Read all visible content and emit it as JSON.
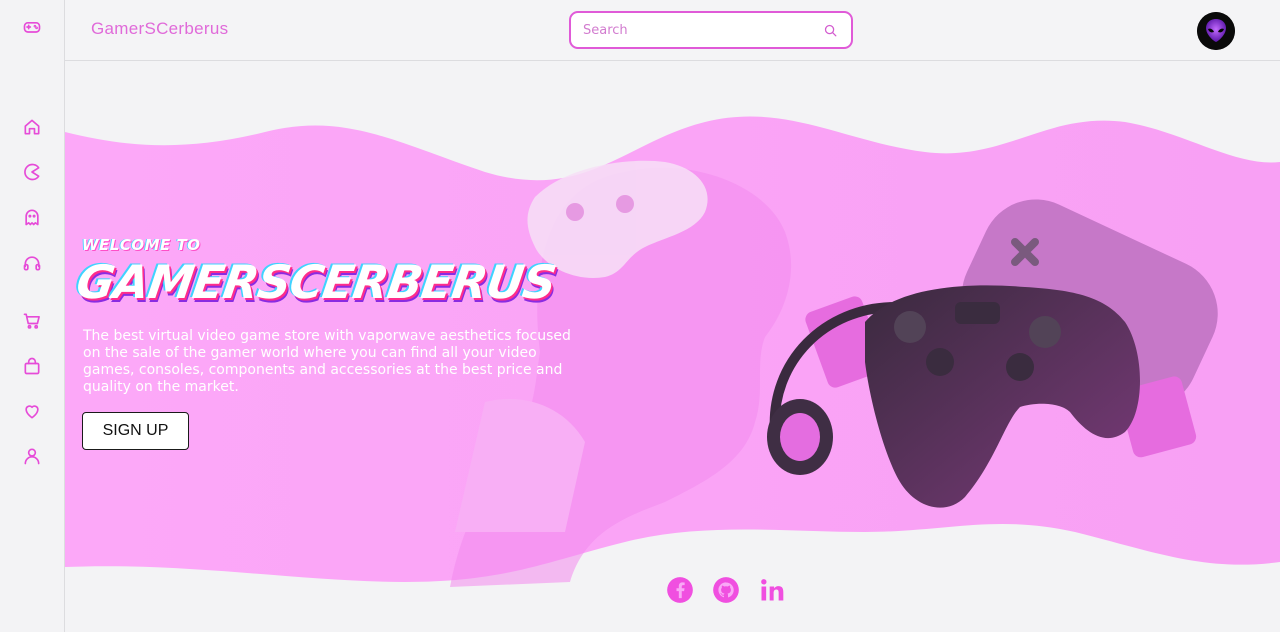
{
  "app": {
    "brand": "GamerSCerberus"
  },
  "search": {
    "placeholder": "Search"
  },
  "sidebar": {
    "items": [
      {
        "name": "gamepad-icon"
      },
      {
        "name": "home-icon"
      },
      {
        "name": "pacman-icon"
      },
      {
        "name": "ghost-icon"
      },
      {
        "name": "headphones-icon"
      },
      {
        "name": "cart-icon"
      },
      {
        "name": "bag-icon"
      },
      {
        "name": "heart-icon"
      },
      {
        "name": "user-icon"
      }
    ]
  },
  "hero": {
    "welcome": "WELCOME TO",
    "title": "GAMERSCERBERUS",
    "description": "The best virtual video game store with vaporwave aesthetics focused on the sale of the gamer world where you can find all your video games, consoles, components and accessories at the best price and quality on the market.",
    "signup_label": "SIGN UP"
  },
  "social": [
    {
      "name": "facebook-icon"
    },
    {
      "name": "github-icon"
    },
    {
      "name": "linkedin-icon"
    }
  ],
  "colors": {
    "accent": "#e64bd8",
    "hero_pink": "#f9a9f6",
    "background": "#f3f3f5"
  }
}
